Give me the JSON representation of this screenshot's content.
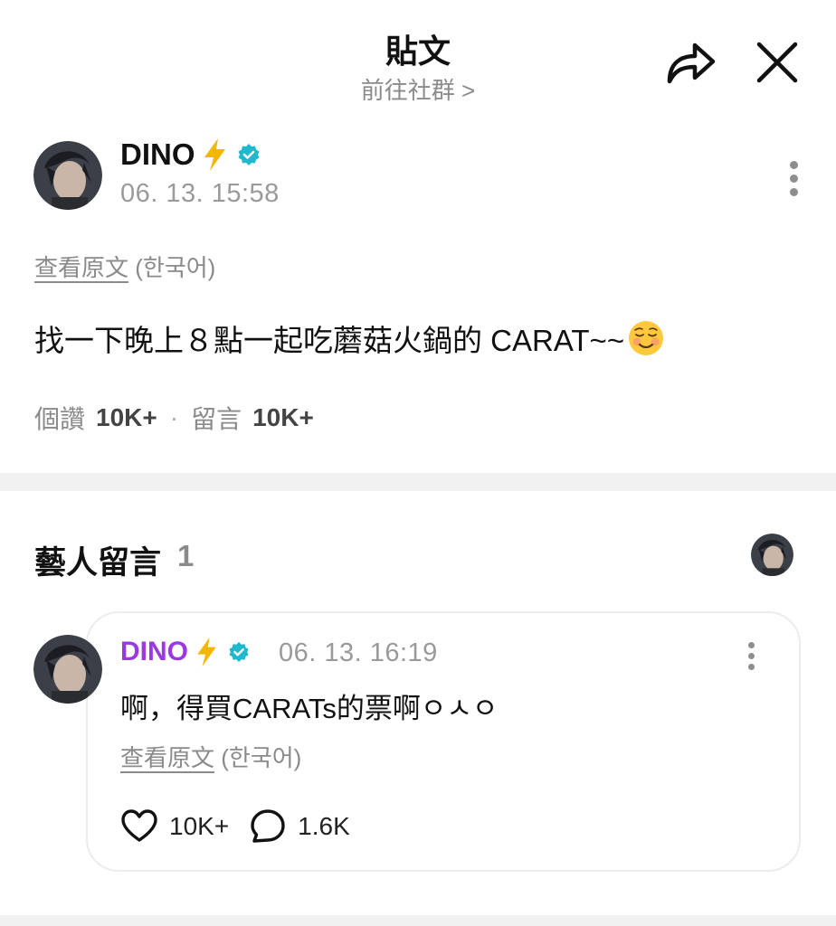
{
  "header": {
    "title": "貼文",
    "subtitle": "前往社群 >"
  },
  "post": {
    "author": "DINO",
    "timestamp": "06. 13. 15:58",
    "translate_link": "查看原文",
    "translate_lang": "(한국어)",
    "body": "找一下晚上８點一起吃蘑菇火鍋的 CARAT~~",
    "stats": {
      "likes_label": "個讚",
      "likes_value": "10K+",
      "separator": "·",
      "comments_label": "留言",
      "comments_value": "10K+"
    }
  },
  "artist_comments": {
    "title": "藝人留言",
    "count": "1",
    "items": [
      {
        "author": "DINO",
        "timestamp": "06. 13. 16:19",
        "body": "啊，得買CARATs的票啊ㅇㅅㅇ",
        "translate_link": "查看原文",
        "translate_lang": "(한국어)",
        "likes": "10K+",
        "replies": "1.6K"
      }
    ]
  },
  "colors": {
    "artist_name": "#9b39e0",
    "verified": "#1fb8cc",
    "bolt": "#f2b705",
    "muted": "#8a8a8a"
  },
  "icons": {
    "share": "share-arrow-icon",
    "close": "close-icon",
    "more": "more-vertical-icon",
    "verified": "verified-badge-icon",
    "bolt": "lightning-bolt-icon",
    "emoji": "smiling-face-emoji",
    "like": "heart-icon",
    "reply": "speech-bubble-icon"
  }
}
